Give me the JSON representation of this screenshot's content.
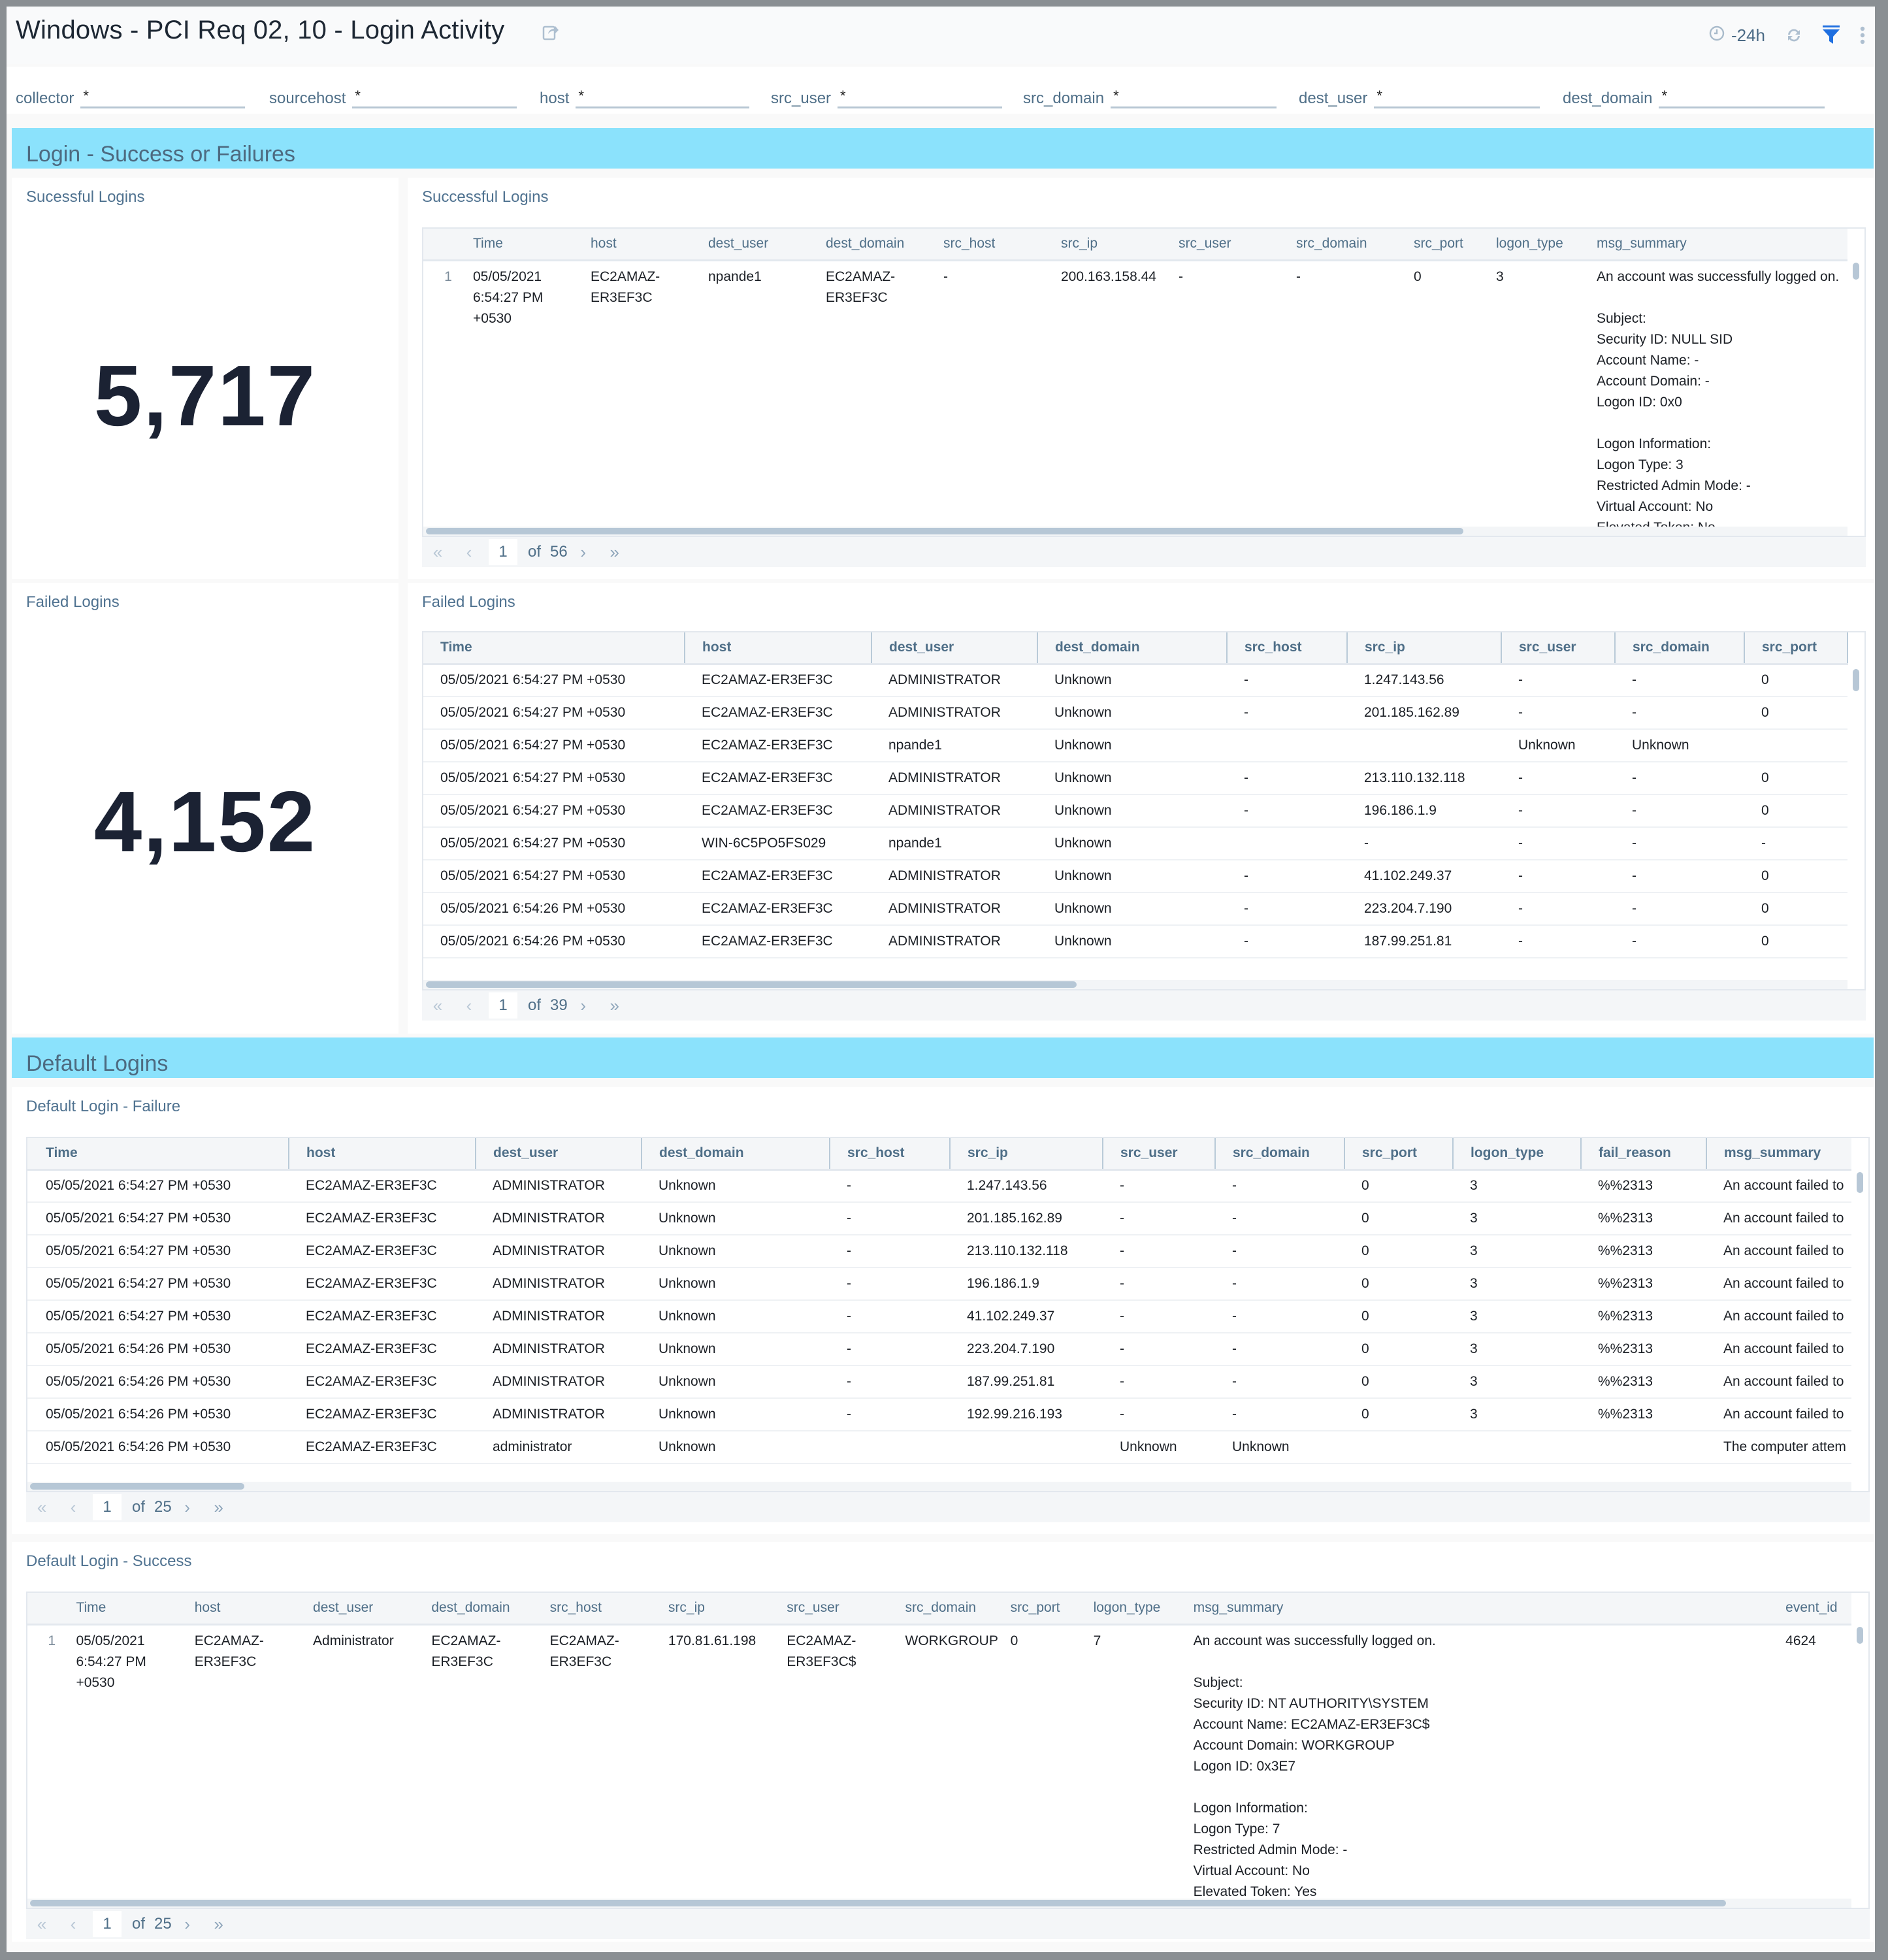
{
  "header": {
    "title": "Windows - PCI Req 02, 10 - Login Activity",
    "time_range": "-24h",
    "icons": {
      "share": "share-icon",
      "clock": "clock-icon",
      "refresh": "refresh-icon",
      "filter": "filter-icon",
      "more": "more-vertical-icon"
    },
    "accent_color": "#1a73e8"
  },
  "filters": [
    {
      "label": "collector",
      "value": "*"
    },
    {
      "label": "sourcehost",
      "value": "*"
    },
    {
      "label": "host",
      "value": "*"
    },
    {
      "label": "src_user",
      "value": "*"
    },
    {
      "label": "src_domain",
      "value": "*"
    },
    {
      "label": "dest_user",
      "value": "*"
    },
    {
      "label": "dest_domain",
      "value": "*"
    }
  ],
  "sections": {
    "login": {
      "title": "Login - Success or Failures",
      "color": "#8be2fc"
    },
    "default": {
      "title": "Default Logins",
      "color": "#8be2fc"
    }
  },
  "successful_count": {
    "title": "Sucessful Logins",
    "value": "5,717"
  },
  "failed_count": {
    "title": "Failed Logins",
    "value": "4,152"
  },
  "successful_table": {
    "title": "Successful Logins",
    "columns": [
      "",
      "Time",
      "host",
      "dest_user",
      "dest_domain",
      "src_host",
      "src_ip",
      "src_user",
      "src_domain",
      "src_port",
      "logon_type",
      "msg_summary"
    ],
    "rows": [
      {
        "num": "1",
        "time": "05/05/2021 6:54:27 PM +0530",
        "host": "EC2AMAZ-ER3EF3C",
        "dest_user": "npande1",
        "dest_domain": "EC2AMAZ-ER3EF3C",
        "src_host": "-",
        "src_ip": "200.163.158.44",
        "src_user": "-",
        "src_domain": "-",
        "src_port": "0",
        "logon_type": "3",
        "msg_summary": "An account was successfully logged on.\n\nSubject:\nSecurity ID: NULL SID\nAccount Name: -\nAccount Domain: -\nLogon ID: 0x0\n\nLogon Information:\nLogon Type: 3\nRestricted Admin Mode: -\nVirtual Account: No\nElevated Token: No"
      }
    ],
    "pager": {
      "page": "1",
      "of_label": "of",
      "total": "56"
    }
  },
  "failed_table": {
    "title": "Failed Logins",
    "columns": [
      "Time",
      "host",
      "dest_user",
      "dest_domain",
      "src_host",
      "src_ip",
      "src_user",
      "src_domain",
      "src_port"
    ],
    "rows": [
      [
        "05/05/2021 6:54:27 PM +0530",
        "EC2AMAZ-ER3EF3C",
        "ADMINISTRATOR",
        "Unknown",
        "-",
        "1.247.143.56",
        "-",
        "-",
        "0"
      ],
      [
        "05/05/2021 6:54:27 PM +0530",
        "EC2AMAZ-ER3EF3C",
        "ADMINISTRATOR",
        "Unknown",
        "-",
        "201.185.162.89",
        "-",
        "-",
        "0"
      ],
      [
        "05/05/2021 6:54:27 PM +0530",
        "EC2AMAZ-ER3EF3C",
        "npande1",
        "Unknown",
        "",
        "",
        "Unknown",
        "Unknown",
        ""
      ],
      [
        "05/05/2021 6:54:27 PM +0530",
        "EC2AMAZ-ER3EF3C",
        "ADMINISTRATOR",
        "Unknown",
        "-",
        "213.110.132.118",
        "-",
        "-",
        "0"
      ],
      [
        "05/05/2021 6:54:27 PM +0530",
        "EC2AMAZ-ER3EF3C",
        "ADMINISTRATOR",
        "Unknown",
        "-",
        "196.186.1.9",
        "-",
        "-",
        "0"
      ],
      [
        "05/05/2021 6:54:27 PM +0530",
        "WIN-6C5PO5FS029",
        "npande1",
        "Unknown",
        "",
        "-",
        "-",
        "-",
        "-"
      ],
      [
        "05/05/2021 6:54:27 PM +0530",
        "EC2AMAZ-ER3EF3C",
        "ADMINISTRATOR",
        "Unknown",
        "-",
        "41.102.249.37",
        "-",
        "-",
        "0"
      ],
      [
        "05/05/2021 6:54:26 PM +0530",
        "EC2AMAZ-ER3EF3C",
        "ADMINISTRATOR",
        "Unknown",
        "-",
        "223.204.7.190",
        "-",
        "-",
        "0"
      ],
      [
        "05/05/2021 6:54:26 PM +0530",
        "EC2AMAZ-ER3EF3C",
        "ADMINISTRATOR",
        "Unknown",
        "-",
        "187.99.251.81",
        "-",
        "-",
        "0"
      ]
    ],
    "pager": {
      "page": "1",
      "of_label": "of",
      "total": "39"
    }
  },
  "default_failure_table": {
    "title": "Default Login - Failure",
    "columns": [
      "Time",
      "host",
      "dest_user",
      "dest_domain",
      "src_host",
      "src_ip",
      "src_user",
      "src_domain",
      "src_port",
      "logon_type",
      "fail_reason",
      "msg_summary"
    ],
    "rows": [
      [
        "05/05/2021 6:54:27 PM +0530",
        "EC2AMAZ-ER3EF3C",
        "ADMINISTRATOR",
        "Unknown",
        "-",
        "1.247.143.56",
        "-",
        "-",
        "0",
        "3",
        "%%2313",
        "An account failed to"
      ],
      [
        "05/05/2021 6:54:27 PM +0530",
        "EC2AMAZ-ER3EF3C",
        "ADMINISTRATOR",
        "Unknown",
        "-",
        "201.185.162.89",
        "-",
        "-",
        "0",
        "3",
        "%%2313",
        "An account failed to"
      ],
      [
        "05/05/2021 6:54:27 PM +0530",
        "EC2AMAZ-ER3EF3C",
        "ADMINISTRATOR",
        "Unknown",
        "-",
        "213.110.132.118",
        "-",
        "-",
        "0",
        "3",
        "%%2313",
        "An account failed to"
      ],
      [
        "05/05/2021 6:54:27 PM +0530",
        "EC2AMAZ-ER3EF3C",
        "ADMINISTRATOR",
        "Unknown",
        "-",
        "196.186.1.9",
        "-",
        "-",
        "0",
        "3",
        "%%2313",
        "An account failed to"
      ],
      [
        "05/05/2021 6:54:27 PM +0530",
        "EC2AMAZ-ER3EF3C",
        "ADMINISTRATOR",
        "Unknown",
        "-",
        "41.102.249.37",
        "-",
        "-",
        "0",
        "3",
        "%%2313",
        "An account failed to"
      ],
      [
        "05/05/2021 6:54:26 PM +0530",
        "EC2AMAZ-ER3EF3C",
        "ADMINISTRATOR",
        "Unknown",
        "-",
        "223.204.7.190",
        "-",
        "-",
        "0",
        "3",
        "%%2313",
        "An account failed to"
      ],
      [
        "05/05/2021 6:54:26 PM +0530",
        "EC2AMAZ-ER3EF3C",
        "ADMINISTRATOR",
        "Unknown",
        "-",
        "187.99.251.81",
        "-",
        "-",
        "0",
        "3",
        "%%2313",
        "An account failed to"
      ],
      [
        "05/05/2021 6:54:26 PM +0530",
        "EC2AMAZ-ER3EF3C",
        "ADMINISTRATOR",
        "Unknown",
        "-",
        "192.99.216.193",
        "-",
        "-",
        "0",
        "3",
        "%%2313",
        "An account failed to"
      ],
      [
        "05/05/2021 6:54:26 PM +0530",
        "EC2AMAZ-ER3EF3C",
        "administrator",
        "Unknown",
        "",
        "",
        "Unknown",
        "Unknown",
        "",
        "",
        "",
        "The computer attem"
      ]
    ],
    "pager": {
      "page": "1",
      "of_label": "of",
      "total": "25"
    }
  },
  "default_success_table": {
    "title": "Default Login - Success",
    "columns": [
      "",
      "Time",
      "host",
      "dest_user",
      "dest_domain",
      "src_host",
      "src_ip",
      "src_user",
      "src_domain",
      "src_port",
      "logon_type",
      "msg_summary",
      "event_id"
    ],
    "rows": [
      {
        "num": "1",
        "time": "05/05/2021 6:54:27 PM +0530",
        "host": "EC2AMAZ-ER3EF3C",
        "dest_user": "Administrator",
        "dest_domain": "EC2AMAZ-ER3EF3C",
        "src_host": "EC2AMAZ-ER3EF3C",
        "src_ip": "170.81.61.198",
        "src_user": "EC2AMAZ-ER3EF3C$",
        "src_domain": "WORKGROUP",
        "src_port": "0",
        "logon_type": "7",
        "msg_summary": "An account was successfully logged on.\n\nSubject:\nSecurity ID: NT AUTHORITY\\SYSTEM\nAccount Name: EC2AMAZ-ER3EF3C$\nAccount Domain: WORKGROUP\nLogon ID: 0x3E7\n\nLogon Information:\nLogon Type: 7\nRestricted Admin Mode: -\nVirtual Account: No\nElevated Token: Yes",
        "event_id": "4624"
      }
    ],
    "pager": {
      "page": "1",
      "of_label": "of",
      "total": "25"
    }
  }
}
